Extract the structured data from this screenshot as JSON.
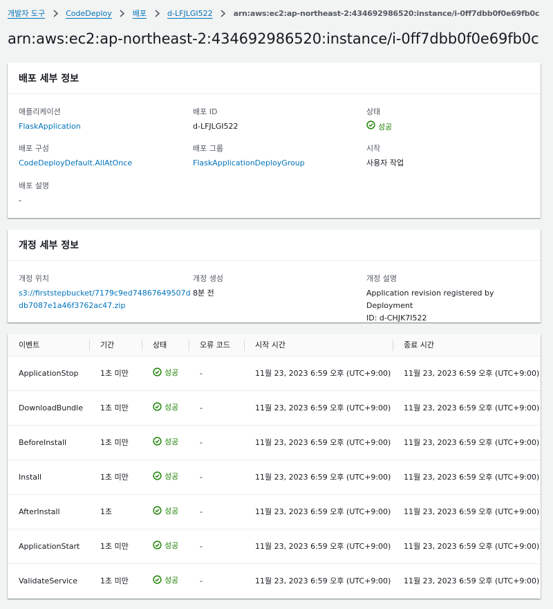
{
  "breadcrumb": {
    "items": [
      "개발자 도구",
      "CodeDeploy",
      "배포",
      "d-LFJLGI522"
    ],
    "current": "arn:aws:ec2:ap-northeast-2:434692986520:instance/i-0ff7dbb0f0e69fb0c"
  },
  "page_title": "arn:aws:ec2:ap-northeast-2:434692986520:instance/i-0ff7dbb0f0e69fb0c",
  "deploy_details": {
    "header": "배포 세부 정보",
    "application_label": "애플리케이션",
    "application_value": "FlaskApplication",
    "deploy_id_label": "배포 ID",
    "deploy_id_value": "d-LFJLGI522",
    "status_label": "상태",
    "status_value": "성공",
    "config_label": "배포 구성",
    "config_value": "CodeDeployDefault.AllAtOnce",
    "group_label": "배포 그룹",
    "group_value": "FlaskApplicationDeployGroup",
    "start_label": "시작",
    "start_value": "사용자 작업",
    "desc_label": "배포 설명",
    "desc_value": "-"
  },
  "revision_details": {
    "header": "개정 세부 정보",
    "location_label": "개정 위치",
    "location_line1": "s3://firststepbucket/7179c9ed74867649507d",
    "location_line2": "db7087e1a46f3762ac47.zip",
    "created_label": "개정 생성",
    "created_value": "8분 전",
    "desc_label": "개정 설명",
    "desc_line1": "Application revision registered by Deployment",
    "desc_line2": "ID: d-CHJK7I522"
  },
  "events_table": {
    "columns": [
      "이벤트",
      "기간",
      "상태",
      "오류 코드",
      "시작 시간",
      "종료 시간"
    ],
    "rows": [
      {
        "event": "ApplicationStop",
        "duration": "1초 미만",
        "status": "성공",
        "error": "-",
        "start": "11월 23, 2023 6:59 오후 (UTC+9:00)",
        "end": "11월 23, 2023 6:59 오후 (UTC+9:00)"
      },
      {
        "event": "DownloadBundle",
        "duration": "1초 미만",
        "status": "성공",
        "error": "-",
        "start": "11월 23, 2023 6:59 오후 (UTC+9:00)",
        "end": "11월 23, 2023 6:59 오후 (UTC+9:00)"
      },
      {
        "event": "BeforeInstall",
        "duration": "1초 미만",
        "status": "성공",
        "error": "-",
        "start": "11월 23, 2023 6:59 오후 (UTC+9:00)",
        "end": "11월 23, 2023 6:59 오후 (UTC+9:00)"
      },
      {
        "event": "Install",
        "duration": "1초 미만",
        "status": "성공",
        "error": "-",
        "start": "11월 23, 2023 6:59 오후 (UTC+9:00)",
        "end": "11월 23, 2023 6:59 오후 (UTC+9:00)"
      },
      {
        "event": "AfterInstall",
        "duration": "1초",
        "status": "성공",
        "error": "-",
        "start": "11월 23, 2023 6:59 오후 (UTC+9:00)",
        "end": "11월 23, 2023 6:59 오후 (UTC+9:00)"
      },
      {
        "event": "ApplicationStart",
        "duration": "1초 미만",
        "status": "성공",
        "error": "-",
        "start": "11월 23, 2023 6:59 오후 (UTC+9:00)",
        "end": "11월 23, 2023 6:59 오후 (UTC+9:00)"
      },
      {
        "event": "ValidateService",
        "duration": "1초 미만",
        "status": "성공",
        "error": "-",
        "start": "11월 23, 2023 6:59 오후 (UTC+9:00)",
        "end": "11월 23, 2023 6:59 오후 (UTC+9:00)"
      }
    ]
  },
  "icons": {
    "breadcrumb_separator": "chevron-right-icon",
    "status_success": "check-circle-icon"
  },
  "colors": {
    "link": "#0073bb",
    "success": "#1d8102",
    "background": "#f2f3f3"
  }
}
